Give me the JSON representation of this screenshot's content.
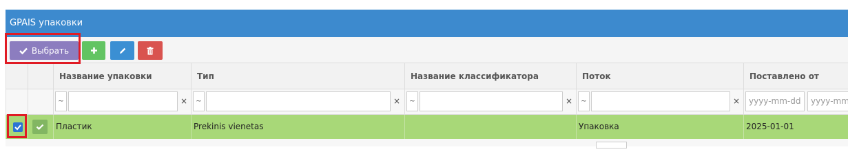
{
  "panel": {
    "title": "GPAIS упаковки"
  },
  "toolbar": {
    "select_label": "Выбрать",
    "add_icon": "plus-icon",
    "edit_icon": "pencil-icon",
    "delete_icon": "trash-icon"
  },
  "table": {
    "columns": [
      "Название упаковки",
      "Тип",
      "Название классификатора",
      "Поток",
      "Поставлено от"
    ],
    "filters": {
      "operator": "~",
      "clear": "×",
      "date_from_placeholder": "yyyy-mm-dd",
      "date_to_placeholder": "yyyy-mm-dd"
    },
    "rows": [
      {
        "selected": true,
        "name": "Пластик",
        "type": "Prekinis vienetas",
        "classifier": "",
        "flow": "Упаковка",
        "delivered_from": "2025-01-01"
      }
    ]
  },
  "colors": {
    "header_bar": "#3d8ace",
    "select_button": "#8c7dbf",
    "add_button": "#62c462",
    "edit_button": "#3b8fd3",
    "delete_button": "#d9534f",
    "selected_row": "#a8d878",
    "highlight": "#e01b24"
  }
}
